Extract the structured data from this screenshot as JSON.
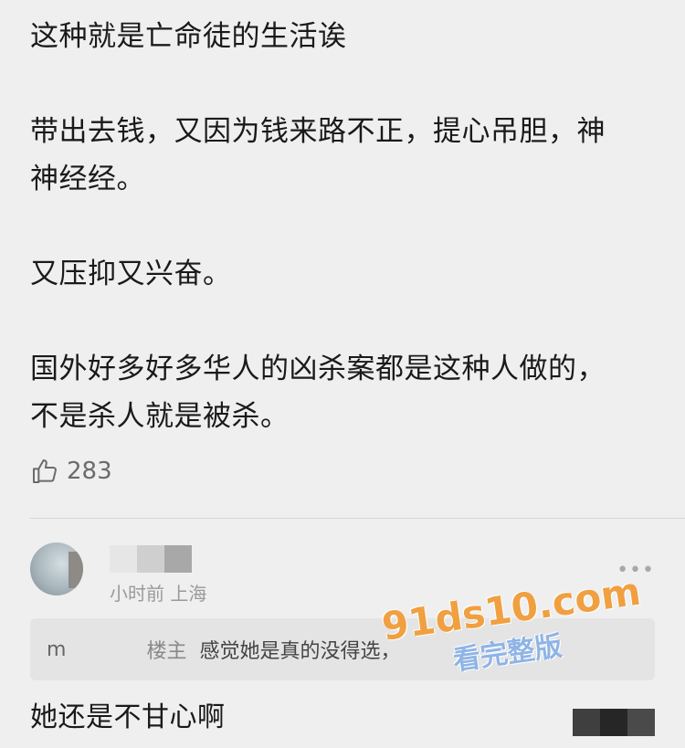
{
  "post": {
    "paragraphs": [
      "这种就是亡命徒的生活诶",
      "带出去钱，又因为钱来路不正，提心吊胆，神\n神经经。",
      "又压抑又兴奋。",
      "国外好多好多华人的凶杀案都是这种人做的，\n不是杀人就是被杀。"
    ],
    "like_count": "283"
  },
  "comment": {
    "meta": "小时前 上海",
    "more": "•••",
    "quote": {
      "author": "m",
      "tag": "楼主",
      "text": "感觉她是真的没得选，"
    },
    "reply_text": "她还是不甘心啊",
    "username_mosaic_colors": [
      "#e6e6e6",
      "#cfcfcf",
      "#a8a8a8"
    ],
    "corner_mosaic_colors": [
      "#3f3f3f",
      "#262626",
      "#4a4a4a"
    ]
  },
  "watermark": {
    "domain": "91ds10.com",
    "subtitle": "看完整版"
  },
  "icons": {
    "like": "thumbs-up-icon",
    "more": "more-dots-icon"
  }
}
